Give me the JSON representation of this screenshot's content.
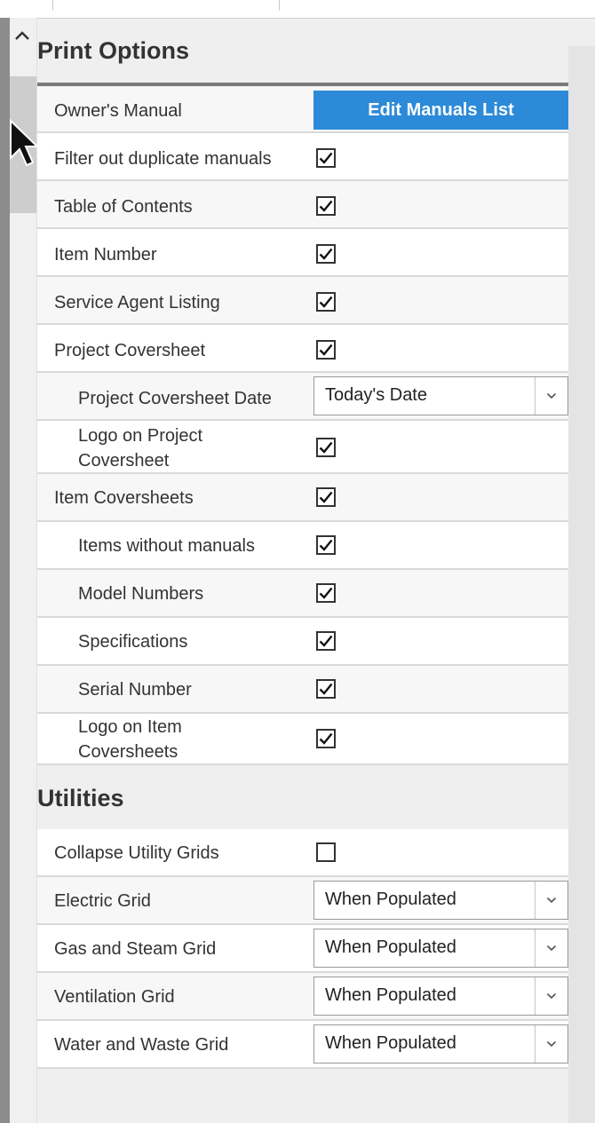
{
  "print_options": {
    "title": "Print Options",
    "edit_manuals_button": "Edit Manuals List",
    "rows": [
      {
        "label": "Owner's Manual",
        "control": "button"
      },
      {
        "label": "Filter out duplicate manuals",
        "control": "checkbox",
        "checked": true
      },
      {
        "label": "Table of Contents",
        "control": "checkbox",
        "checked": true
      },
      {
        "label": "Item Number",
        "control": "checkbox",
        "checked": true
      },
      {
        "label": "Service Agent Listing",
        "control": "checkbox",
        "checked": true
      },
      {
        "label": "Project Coversheet",
        "control": "checkbox",
        "checked": true
      },
      {
        "label": "Project Coversheet Date",
        "control": "select",
        "value": "Today's Date"
      },
      {
        "label_line1": "Logo on Project",
        "label_line2": "Coversheet",
        "control": "checkbox",
        "checked": true
      },
      {
        "label": "Item Coversheets",
        "control": "checkbox",
        "checked": true
      },
      {
        "label": "Items without manuals",
        "control": "checkbox",
        "checked": true
      },
      {
        "label": "Model Numbers",
        "control": "checkbox",
        "checked": true
      },
      {
        "label": "Specifications",
        "control": "checkbox",
        "checked": true
      },
      {
        "label": "Serial Number",
        "control": "checkbox",
        "checked": true
      },
      {
        "label_line1": "Logo on Item",
        "label_line2": "Coversheets",
        "control": "checkbox",
        "checked": true
      }
    ]
  },
  "utilities": {
    "title": "Utilities",
    "rows": [
      {
        "label": "Collapse Utility Grids",
        "control": "checkbox",
        "checked": false
      },
      {
        "label": "Electric Grid",
        "control": "select",
        "value": "When Populated"
      },
      {
        "label": "Gas and Steam Grid",
        "control": "select",
        "value": "When Populated"
      },
      {
        "label": "Ventilation Grid",
        "control": "select",
        "value": "When Populated"
      },
      {
        "label": "Water and Waste Grid",
        "control": "select",
        "value": "When Populated"
      }
    ]
  },
  "icons": {
    "scroll_up": "chevron-up-icon",
    "dropdown": "chevron-down-icon",
    "check": "check-icon",
    "cursor": "mouse-pointer-icon"
  },
  "colors": {
    "accent_button": "#2d8ad8",
    "title_rule": "#7a7a7a"
  }
}
